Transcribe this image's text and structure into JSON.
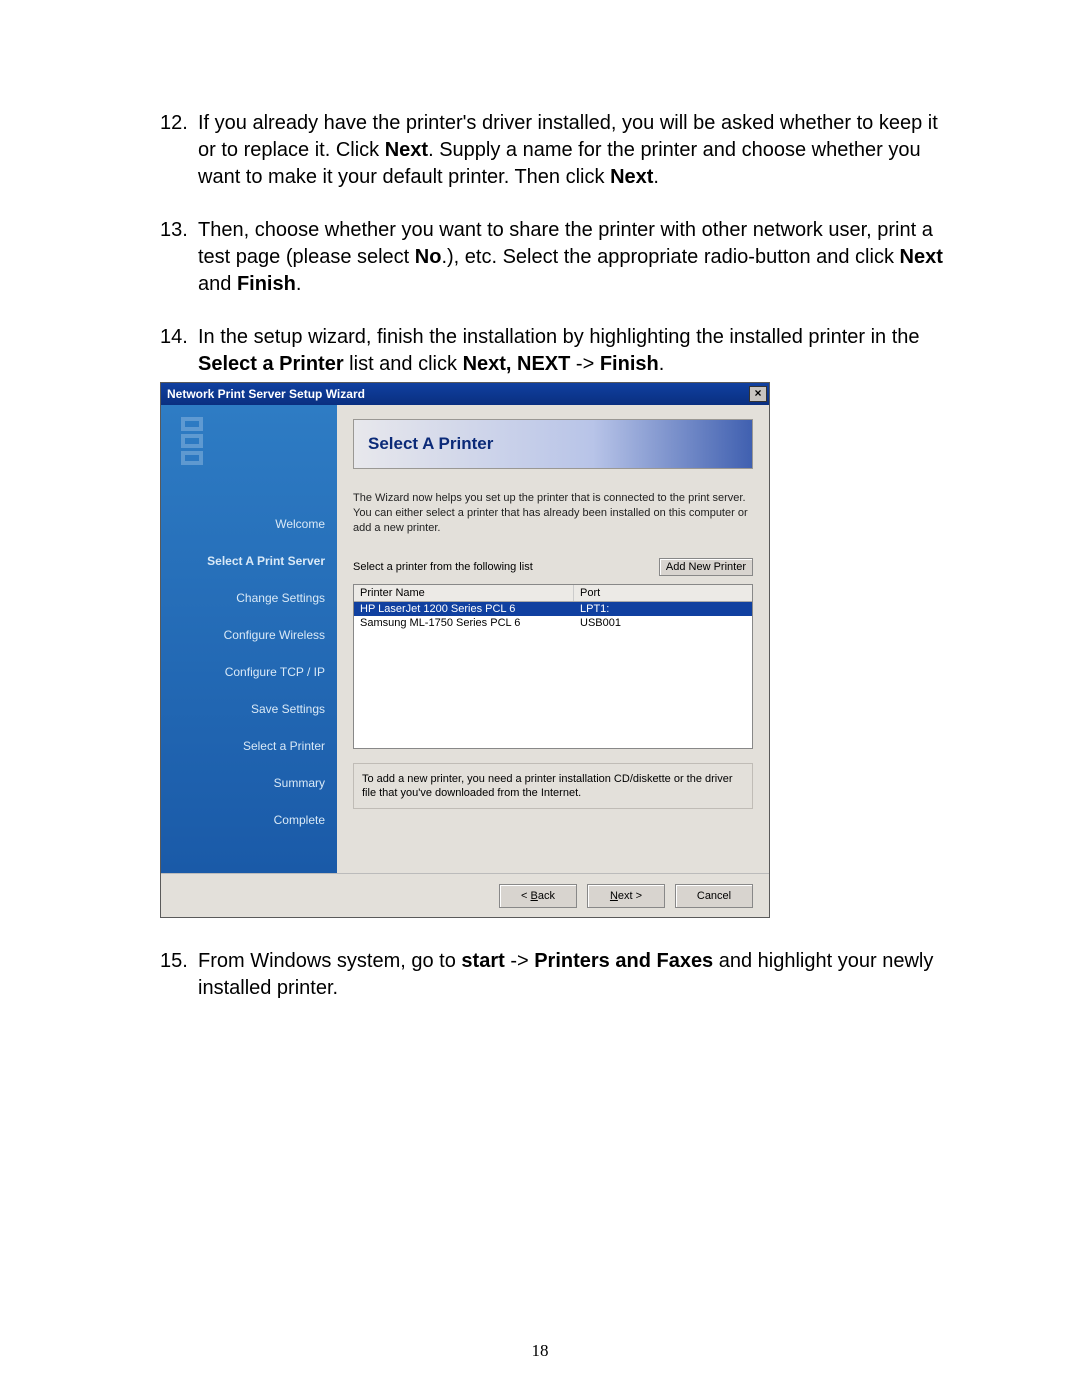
{
  "items": [
    {
      "num": "12.",
      "parts": [
        {
          "t": "If you already have the printer's driver installed, you will be asked whether to keep it or to replace it. Click ",
          "b": false
        },
        {
          "t": "Next",
          "b": true
        },
        {
          "t": ". Supply a name for the printer and choose whether you want to make it your default printer. Then click ",
          "b": false
        },
        {
          "t": "Next",
          "b": true
        },
        {
          "t": ".",
          "b": false
        }
      ]
    },
    {
      "num": "13.",
      "parts": [
        {
          "t": "Then, choose whether you want to share the printer with other network user, print a test page (please select ",
          "b": false
        },
        {
          "t": "No",
          "b": true
        },
        {
          "t": ".), etc. Select the appropriate radio-button and click ",
          "b": false
        },
        {
          "t": "Next",
          "b": true
        },
        {
          "t": " and ",
          "b": false
        },
        {
          "t": "Finish",
          "b": true
        },
        {
          "t": ".",
          "b": false
        }
      ]
    },
    {
      "num": "14.",
      "parts": [
        {
          "t": "In the setup wizard, finish the installation by highlighting the installed printer in the ",
          "b": false
        },
        {
          "t": "Select a Printer",
          "b": true
        },
        {
          "t": " list and click ",
          "b": false
        },
        {
          "t": "Next, NEXT",
          "b": true
        },
        {
          "t": " -> ",
          "b": false
        },
        {
          "t": "Finish",
          "b": true
        },
        {
          "t": ".",
          "b": false
        }
      ]
    },
    {
      "num": "15.",
      "parts": [
        {
          "t": "From Windows system, go to ",
          "b": false
        },
        {
          "t": "start",
          "b": true
        },
        {
          "t": " -> ",
          "b": false
        },
        {
          "t": "Printers and Faxes",
          "b": true
        },
        {
          "t": " and highlight your newly installed printer.",
          "b": false
        }
      ]
    }
  ],
  "wizard": {
    "title": "Network Print Server Setup Wizard",
    "close": "×",
    "side": [
      "Welcome",
      "Select A Print Server",
      "Change Settings",
      "Configure Wireless",
      "Configure TCP / IP",
      "Save Settings",
      "Select a Printer",
      "Summary",
      "Complete"
    ],
    "side_bold": [
      1
    ],
    "heading": "Select A Printer",
    "intro": "The Wizard now helps you set up the printer that is connected to the print server. You can either select a printer that has already been installed on this computer or add a new printer.",
    "list_label": "Select a printer from the following list",
    "add_btn": "Add New Printer",
    "cols": {
      "name": "Printer Name",
      "port": "Port"
    },
    "rows": [
      {
        "name": "HP LaserJet 1200 Series PCL 6",
        "port": "LPT1:",
        "selected": true
      },
      {
        "name": "Samsung ML-1750 Series PCL 6",
        "port": "USB001",
        "selected": false
      }
    ],
    "tip": "To add a new printer, you need a printer installation CD/diskette or the driver file that you've downloaded from the Internet.",
    "back": "Back",
    "next": "Next >",
    "cancel": "Cancel"
  },
  "page_num": "18"
}
